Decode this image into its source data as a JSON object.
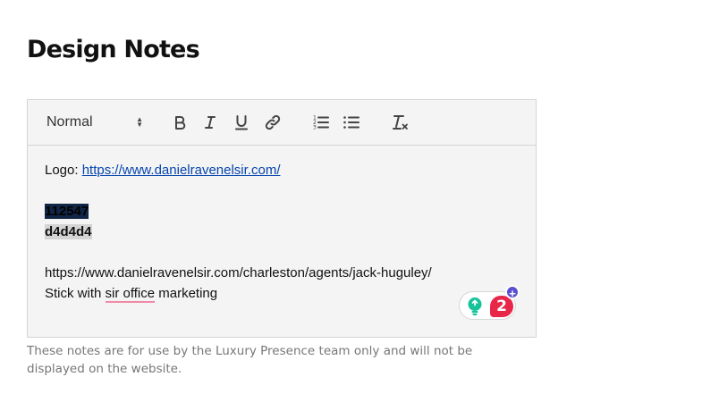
{
  "page": {
    "title": "Design Notes",
    "helper_text": "These notes are for use by the Luxury Presence team only and will not be displayed on the website."
  },
  "toolbar": {
    "format_value": "Normal",
    "buttons": [
      "bold-icon",
      "italic-icon",
      "underline-icon",
      "link-icon",
      "ordered-list-icon",
      "bullet-list-icon",
      "clear-format-icon"
    ]
  },
  "editor": {
    "logo_label": "Logo: ",
    "logo_url": "https://www.danielravenelsir.com/ ",
    "color_dark": "112547",
    "color_light": "d4d4d4",
    "agent_url": "https://www.danielravenelsir.com/charleston/agents/jack-huguley/",
    "note_prefix": "Stick with ",
    "note_flagged": "sir office",
    "note_suffix": " marketing"
  },
  "grammarly": {
    "count": "2",
    "plus": "+"
  },
  "colors": {
    "link": "#0645ad",
    "swatch_dark": "#112547",
    "swatch_light": "#d4d4d4",
    "grammarly_red": "#e8264a",
    "grammarly_green": "#15c39a",
    "grammarly_purple": "#5a4fcf"
  }
}
